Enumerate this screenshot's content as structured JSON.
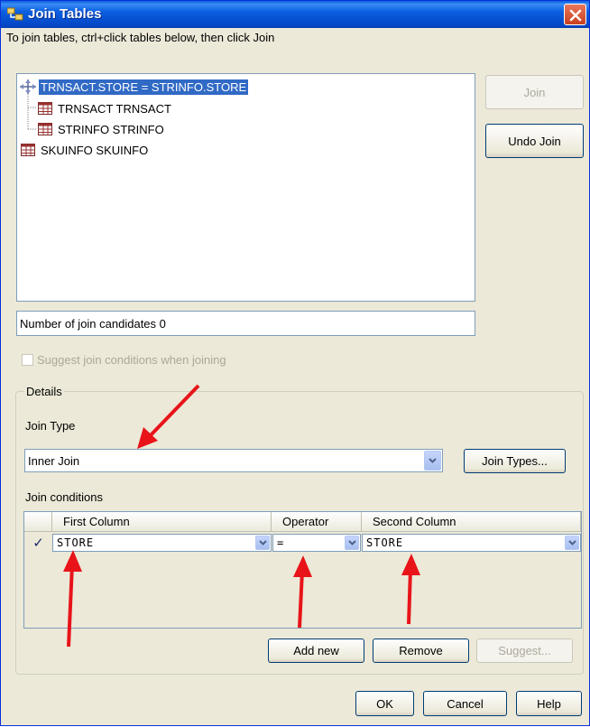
{
  "window": {
    "title": "Join Tables"
  },
  "instructions": "To join tables, ctrl+click tables below, then click Join",
  "tree": {
    "join_node": "TRNSACT.STORE = STRINFO.STORE",
    "children": [
      "TRNSACT TRNSACT",
      "STRINFO STRINFO"
    ],
    "other": "SKUINFO SKUINFO"
  },
  "buttons": {
    "join": "Join",
    "undo_join": "Undo Join",
    "join_types": "Join Types...",
    "add_new": "Add new",
    "remove": "Remove",
    "suggest": "Suggest...",
    "ok": "OK",
    "cancel": "Cancel",
    "help": "Help"
  },
  "candidates_text": "Number of join candidates 0",
  "suggest_checkbox": {
    "label": "Suggest join conditions when joining",
    "checked": false,
    "enabled": false
  },
  "details": {
    "legend": "Details",
    "join_type_label": "Join Type",
    "join_type_value": "Inner Join",
    "conditions_label": "Join conditions"
  },
  "grid": {
    "headers": [
      "First Column",
      "Operator",
      "Second Column"
    ],
    "rows": [
      {
        "checked_glyph": "✓",
        "first": "STORE",
        "operator": "=",
        "second": "STORE"
      }
    ]
  },
  "annotation_color": "#e8141a",
  "icons": [
    "join-icon",
    "table-icon",
    "close-icon",
    "chevron-down-icon"
  ]
}
